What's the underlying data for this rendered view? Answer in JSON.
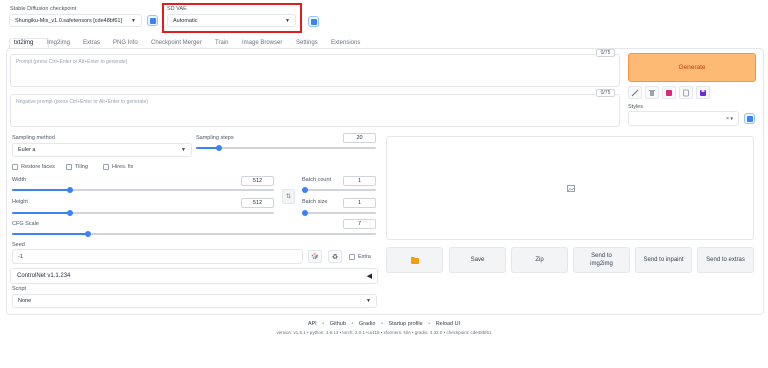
{
  "header": {
    "checkpoint_label": "Stable Diffusion checkpoint",
    "checkpoint_value": "Shungiku-Mix_v1.0.safetensors [cde48bf61]",
    "vae_label": "SD VAE",
    "vae_value": "Automatic"
  },
  "tabs": [
    "txt2img",
    "Img2img",
    "Extras",
    "PNG Info",
    "Checkpoint Merger",
    "Train",
    "Image Browser",
    "Settings",
    "Extensions"
  ],
  "prompt": {
    "placeholder": "Prompt (press Ctrl+Enter or Alt+Enter to generate)",
    "counter": "0/75"
  },
  "negative": {
    "placeholder": "Negative prompt (press Ctrl+Enter or Alt+Enter to generate)",
    "counter": "0/75"
  },
  "generate_label": "Generate",
  "styles_label": "Styles",
  "styles_clear": "× ▾",
  "sampling": {
    "method_label": "Sampling method",
    "method_value": "Euler a",
    "steps_label": "Sampling steps",
    "steps_value": "20",
    "steps_fraction": 0.13
  },
  "checkboxes": {
    "restore_faces": "Restore faces",
    "tiling": "Tiling",
    "hires_fix": "Hires. fix"
  },
  "width": {
    "label": "Width",
    "value": "512",
    "fraction": 0.22
  },
  "height": {
    "label": "Height",
    "value": "512",
    "fraction": 0.22
  },
  "batch_count": {
    "label": "Batch count",
    "value": "1",
    "fraction": 0.0
  },
  "batch_size": {
    "label": "Batch size",
    "value": "1",
    "fraction": 0.0
  },
  "cfg": {
    "label": "CFG Scale",
    "value": "7",
    "fraction": 0.21
  },
  "seed": {
    "label": "Seed",
    "value": "-1",
    "extra_label": "Extra"
  },
  "controlnet_label": "ControlNet v1.1.234",
  "script": {
    "label": "Script",
    "value": "None"
  },
  "output_buttons": {
    "save": "Save",
    "zip": "Zip",
    "send_img2img": "Send to img2img",
    "send_inpaint": "Send to inpaint",
    "send_extras": "Send to extras"
  },
  "footer": {
    "links": [
      "API",
      "Github",
      "Gradio",
      "Startup profile",
      "Reload UI"
    ],
    "sep": "•",
    "version_line": "version: v1.5.1  •  python: 3.9.13  •  torch: 2.0.1+cu118  •  xformers: N/A  •  gradio: 3.32.0  •  checkpoint: cde48bf61"
  },
  "colors": {
    "accent": "#3b82f6",
    "generate_bg": "#fdba74",
    "generate_text": "#c2410c",
    "highlight_border": "#e11d1d"
  }
}
